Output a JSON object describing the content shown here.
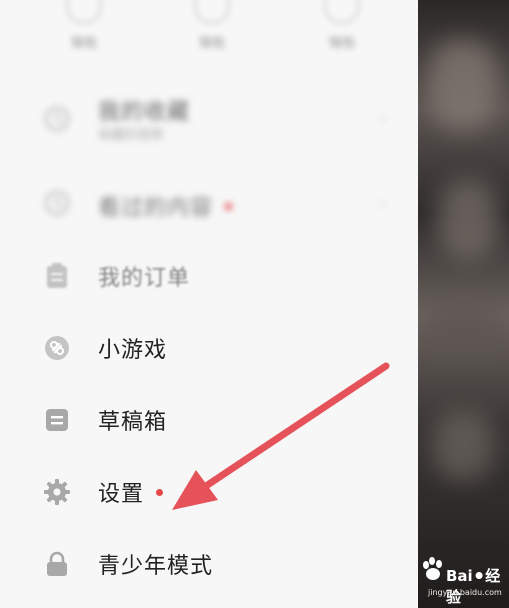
{
  "drawer": {
    "quick": [
      {
        "label": "钱包",
        "icon": "wallet-icon"
      },
      {
        "label": "钱包",
        "icon": "coupon-icon"
      },
      {
        "label": "钱包",
        "icon": "ticket-icon"
      }
    ],
    "items": [
      {
        "label": "我的收藏",
        "sub": "收藏的视频",
        "icon": "clock-icon",
        "blur": true
      },
      {
        "label": "看过的内容",
        "icon": "history-icon",
        "blur": true
      },
      {
        "label": "我的订单",
        "icon": "order-icon"
      },
      {
        "label": "小游戏",
        "icon": "game-icon"
      },
      {
        "label": "草稿箱",
        "icon": "draft-box-icon"
      },
      {
        "label": "设置",
        "icon": "gear-icon",
        "dot": true
      },
      {
        "label": "青少年模式",
        "icon": "lock-icon"
      }
    ]
  },
  "watermark": {
    "brand": "Bai",
    "suffix": "经验",
    "url": "jingyan.baidu.com"
  },
  "colors": {
    "accent_red": "#e4494a",
    "arrow": "#e5525a",
    "drawer_bg": "#f7f7f7"
  }
}
